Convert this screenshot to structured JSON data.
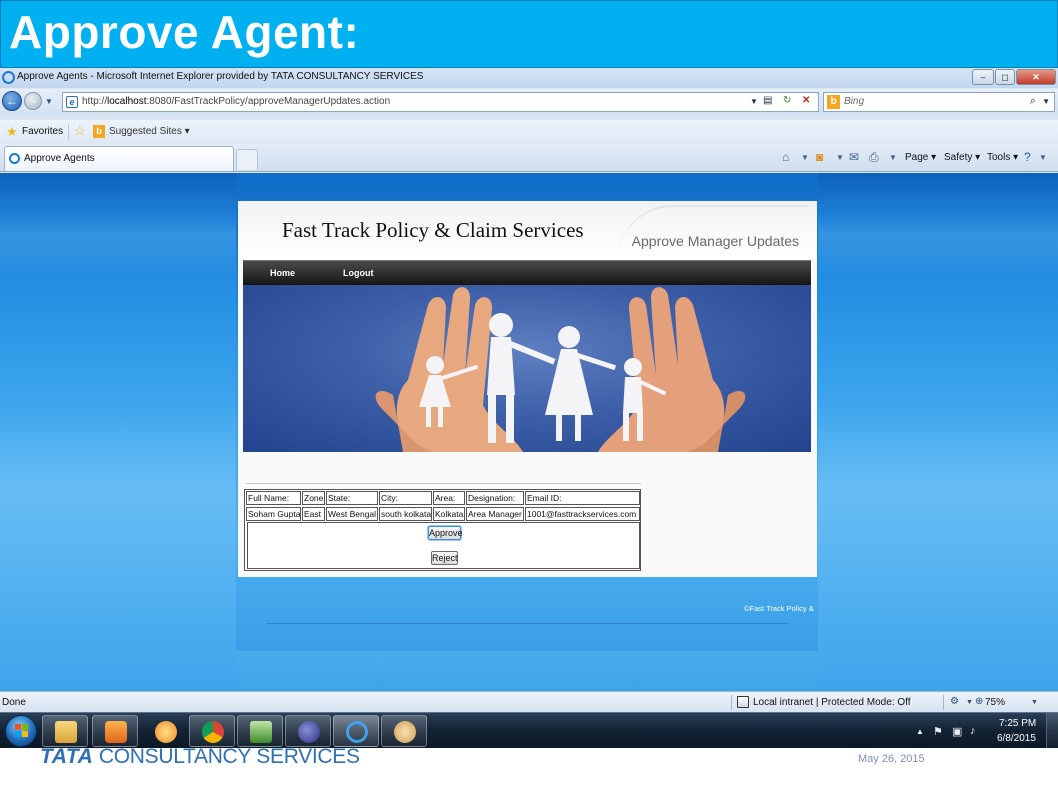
{
  "slide": {
    "title": "Approve Agent:",
    "footer_logo": "CONSULTANCY SERVICES",
    "footer_logo_bold": "TATA",
    "date": "May 26, 2015"
  },
  "window": {
    "title": "Approve Agents - Microsoft Internet Explorer provided by TATA CONSULTANCY SERVICES",
    "controls": {
      "minimize": "–",
      "maximize": "◻",
      "close": "✕"
    }
  },
  "address_bar": {
    "url_prefix": "http://",
    "url_host": "localhost",
    "url_rest": ":8080/FastTrackPolicy/approveManagerUpdates.action",
    "search_placeholder": "Bing"
  },
  "favorites_bar": {
    "favorites_label": "Favorites",
    "suggested_label": "Suggested Sites ▾"
  },
  "tabs": [
    {
      "label": "Approve Agents",
      "active": true
    }
  ],
  "command_bar": {
    "page": "Page ▾",
    "safety": "Safety ▾",
    "tools": "Tools ▾"
  },
  "webpage": {
    "site_title": "Fast Track Policy & Claim Services",
    "subtitle": "Approve Manager Updates",
    "nav": [
      {
        "label": "Home"
      },
      {
        "label": "Logout"
      }
    ],
    "table": {
      "headers": [
        "Full Name:",
        "Zone:",
        "State:",
        "City:",
        "Area:",
        "Designation:",
        "Email ID:"
      ],
      "row": [
        "Soham Gupta",
        "East",
        "West Bengal",
        "south kolkata",
        "Kolkata",
        "Area Manager",
        "1001@fasttrackservices.com"
      ]
    },
    "approve_label": "Approve",
    "reject_label": "Reject",
    "footer_text": "©Fast Track Policy &"
  },
  "status_bar": {
    "status": "Done",
    "zone": "Local intranet | Protected Mode: Off",
    "zoom": "75%"
  },
  "taskbar": {
    "time": "7:25 PM",
    "date": "6/8/2015",
    "apps": [
      "explorer",
      "media-player",
      "paint-app",
      "chrome",
      "network-app",
      "eclipse",
      "internet-explorer",
      "paint-palette"
    ]
  },
  "colors": {
    "banner": "#00b0f0",
    "tcs_blue": "#2d70b6",
    "nav_bar": "#151515"
  }
}
